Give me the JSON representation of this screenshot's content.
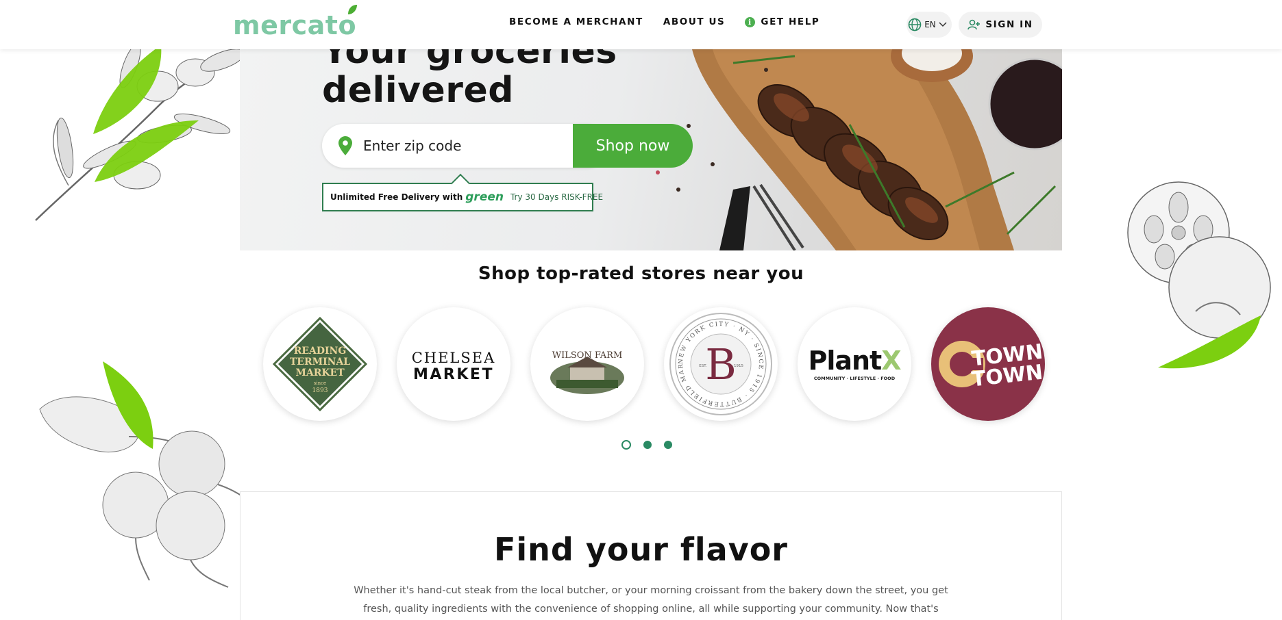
{
  "header": {
    "logo": "mercato",
    "nav": [
      {
        "label": "BECOME A MERCHANT"
      },
      {
        "label": "ABOUT US"
      },
      {
        "label": "GET HELP"
      }
    ],
    "language": "EN",
    "sign_in": "SIGN IN"
  },
  "hero": {
    "title_line1": "Your groceries",
    "title_line2": "delivered",
    "zip_placeholder": "Enter zip code",
    "shop_button": "Shop now",
    "promo": {
      "text": "Unlimited Free Delivery with",
      "brand": "green",
      "trial": "Try 30 Days RISK-FREE"
    }
  },
  "stores": {
    "title": "Shop top-rated stores near you",
    "items": [
      {
        "name": "Reading Terminal Market",
        "lines": [
          "READING",
          "TERMINAL",
          "MARKET"
        ],
        "since": "since",
        "year": "1893"
      },
      {
        "name": "Chelsea Market",
        "lines": [
          "CHELSEA",
          "MARKET"
        ]
      },
      {
        "name": "Wilson Farm",
        "lines": [
          "WILSON FARM"
        ]
      },
      {
        "name": "Butterfield Market",
        "ring": "NEW YORK CITY · NY · SINCE 1915 · BUTTERFIELD MARKET ·",
        "letter": "B",
        "est": "EST.",
        "year": "1915"
      },
      {
        "name": "PlantX",
        "word": "Plant",
        "x": "X",
        "tagline": "COMMUNITY · LIFESTYLE · FOOD"
      },
      {
        "name": "CTown",
        "lines": [
          "TOWN",
          "TOWN"
        ]
      }
    ],
    "pagination": {
      "pages": 3,
      "active": 1
    }
  },
  "flavor": {
    "title": "Find your flavor",
    "text": "Whether it's hand-cut steak from the local butcher, or your morning croissant from the bakery down the street, you get fresh, quality ingredients with the convenience of shopping online, all while supporting your community. Now that's satisfying."
  },
  "colors": {
    "brand_green": "#4bac3a",
    "logo_green": "#7ec8a4",
    "accent_teal": "#2a8a63",
    "ctown": "#8a3248"
  }
}
